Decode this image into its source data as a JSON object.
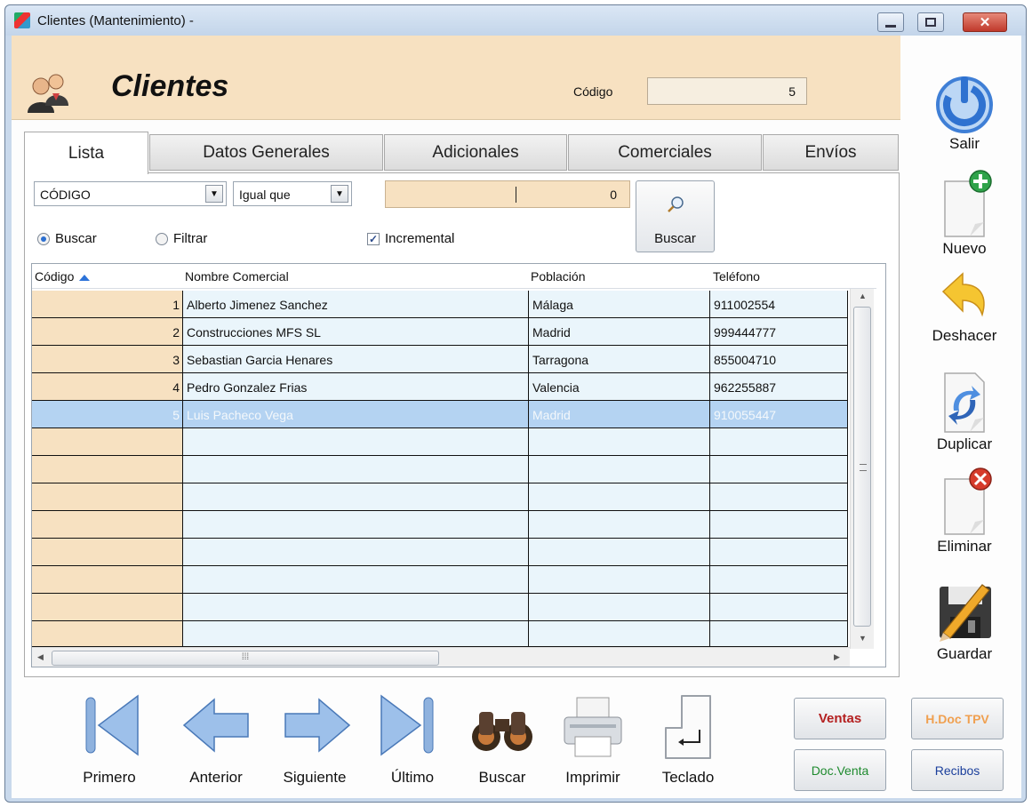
{
  "window": {
    "title": "Clientes (Mantenimiento) -"
  },
  "header": {
    "title": "Clientes",
    "codigo_label": "Código",
    "codigo_value": "5"
  },
  "tabs": [
    {
      "label": "Lista",
      "active": true
    },
    {
      "label": "Datos Generales",
      "active": false
    },
    {
      "label": "Adicionales",
      "active": false
    },
    {
      "label": "Comerciales",
      "active": false
    },
    {
      "label": "Envíos",
      "active": false
    }
  ],
  "search": {
    "field_selected": "CÓDIGO",
    "operator_selected": "Igual que",
    "value": "0",
    "radio_buscar": "Buscar",
    "radio_filtrar": "Filtrar",
    "radio_selected": "Buscar",
    "incremental_label": "Incremental",
    "incremental_checked": true,
    "button_label": "Buscar"
  },
  "grid": {
    "columns": [
      "Código",
      "Nombre Comercial",
      "Población",
      "Teléfono"
    ],
    "sort_column": "Código",
    "rows": [
      {
        "codigo": "1",
        "nombre": "Alberto Jimenez Sanchez",
        "poblacion": "Málaga",
        "telefono": "911002554"
      },
      {
        "codigo": "2",
        "nombre": "Construcciones MFS SL",
        "poblacion": "Madrid",
        "telefono": "999444777"
      },
      {
        "codigo": "3",
        "nombre": "Sebastian Garcia Henares",
        "poblacion": "Tarragona",
        "telefono": "855004710"
      },
      {
        "codigo": "4",
        "nombre": "Pedro Gonzalez Frias",
        "poblacion": "Valencia",
        "telefono": "962255887"
      },
      {
        "codigo": "5",
        "nombre": "Luis Pacheco Vega",
        "poblacion": "Madrid",
        "telefono": "910055447"
      }
    ],
    "selected_row": 5
  },
  "side_actions": {
    "salir": "Salir",
    "nuevo": "Nuevo",
    "deshacer": "Deshacer",
    "duplicar": "Duplicar",
    "eliminar": "Eliminar",
    "guardar": "Guardar"
  },
  "nav": {
    "primero": "Primero",
    "anterior": "Anterior",
    "siguiente": "Siguiente",
    "ultimo": "Último",
    "buscar": "Buscar",
    "imprimir": "Imprimir",
    "teclado": "Teclado"
  },
  "buttons": {
    "ventas": "Ventas",
    "doc_venta": "Doc.Venta",
    "hdoc_tpv": "H.Doc TPV",
    "recibos": "Recibos"
  },
  "colors": {
    "header_bg": "#f7e1c1",
    "row_bg": "#eaf5fb",
    "selected_row_bg": "#b4d3f2",
    "ventas_text": "#b42020",
    "doc_venta_text": "#1e8a2e",
    "hdoc_tpv_text": "#f0a050",
    "recibos_text": "#1b3f9c"
  }
}
